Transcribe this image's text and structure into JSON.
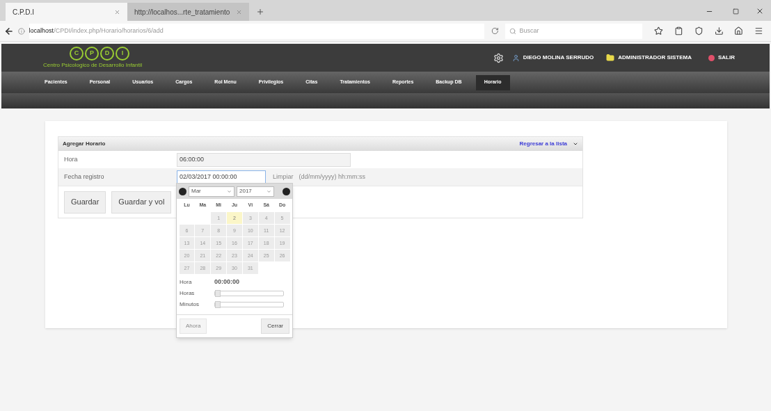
{
  "browser": {
    "tabs": [
      {
        "label": "C.P.D.I",
        "selected": true
      },
      {
        "label": "http://localhos...rte_tratamiento",
        "selected": false
      }
    ],
    "url_host": "localhost",
    "url_path": "/CPDI/index.php/Horario/horarios/6/add",
    "search_placeholder": "Buscar"
  },
  "header": {
    "logo_letters": [
      "C",
      "P",
      "D",
      "I"
    ],
    "logo_subtitle": "Centro Psicologico de Desarrollo Infantil",
    "user": "DIEGO MOLINA SERRUDO",
    "role": "ADMINISTRADOR SISTEMA",
    "logout": "SALIR"
  },
  "nav": [
    {
      "label": "Pacientes",
      "selected": false
    },
    {
      "label": "Personal",
      "selected": false
    },
    {
      "label": "Usuarios",
      "selected": false
    },
    {
      "label": "Cargos",
      "selected": false
    },
    {
      "label": "Rol Menu",
      "selected": false
    },
    {
      "label": "Privilegios",
      "selected": false
    },
    {
      "label": "Citas",
      "selected": false
    },
    {
      "label": "Tratamientos",
      "selected": false
    },
    {
      "label": "Reportes",
      "selected": false
    },
    {
      "label": "Backup DB",
      "selected": false
    },
    {
      "label": "Horario",
      "selected": true
    }
  ],
  "form": {
    "title": "Agregar Horario",
    "back_link": "Regresar a la lista",
    "fields": [
      {
        "label": "Hora",
        "value": "06:00:00"
      },
      {
        "label": "Fecha registro",
        "value": "02/03/2017 00:00:00",
        "clear": "Limpiar",
        "hint": "(dd/mm/yyyy) hh:mm:ss"
      }
    ],
    "buttons": [
      "Guardar",
      "Guardar y vol"
    ]
  },
  "datepicker": {
    "month": "Mar",
    "year": "2017",
    "weekdays": [
      "Lu",
      "Ma",
      "Mi",
      "Ju",
      "Vi",
      "Sá",
      "Do"
    ],
    "days": [
      {
        "label": "1",
        "selected": false
      },
      {
        "label": "2",
        "selected": true
      },
      {
        "label": "3",
        "selected": false
      },
      {
        "label": "4",
        "selected": false
      },
      {
        "label": "5",
        "selected": false
      },
      {
        "label": "6",
        "selected": false
      },
      {
        "label": "7",
        "selected": false
      },
      {
        "label": "8",
        "selected": false
      },
      {
        "label": "9",
        "selected": false
      },
      {
        "label": "10",
        "selected": false
      },
      {
        "label": "11",
        "selected": false
      },
      {
        "label": "12",
        "selected": false
      },
      {
        "label": "13",
        "selected": false
      },
      {
        "label": "14",
        "selected": false
      },
      {
        "label": "15",
        "selected": false
      },
      {
        "label": "16",
        "selected": false
      },
      {
        "label": "17",
        "selected": false
      },
      {
        "label": "18",
        "selected": false
      },
      {
        "label": "19",
        "selected": false
      },
      {
        "label": "20",
        "selected": false
      },
      {
        "label": "21",
        "selected": false
      },
      {
        "label": "22",
        "selected": false
      },
      {
        "label": "23",
        "selected": false
      },
      {
        "label": "24",
        "selected": false
      },
      {
        "label": "25",
        "selected": false
      },
      {
        "label": "26",
        "selected": false
      },
      {
        "label": "27",
        "selected": false
      },
      {
        "label": "28",
        "selected": false
      },
      {
        "label": "29",
        "selected": false
      },
      {
        "label": "30",
        "selected": false
      },
      {
        "label": "31",
        "selected": false
      }
    ],
    "time_label": "Hora",
    "time_value": "00:00:00",
    "sliders": [
      {
        "label": "Horas",
        "level": 0
      },
      {
        "label": "Minutos",
        "level": 0
      }
    ],
    "now_button": "Ahora",
    "close_button": "Cerrar"
  }
}
